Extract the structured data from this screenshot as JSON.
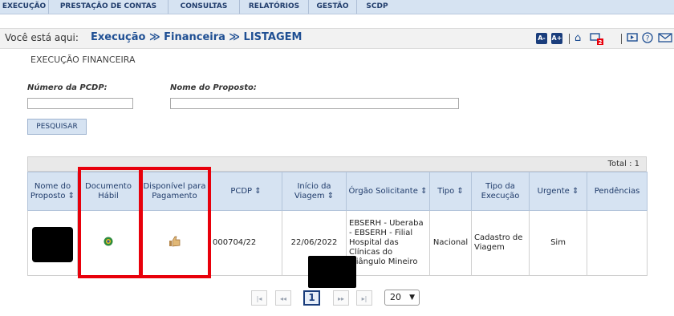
{
  "nav": [
    "EXECUÇÃO",
    "PRESTAÇÃO DE CONTAS",
    "CONSULTAS",
    "RELATÓRIOS",
    "GESTÃO",
    "SCDP"
  ],
  "breadcrumb": {
    "here_label": "Você está aqui:",
    "path": "Execução ≫ Financeira ≫ LISTAGEM"
  },
  "toolbar": {
    "font_decrease": "A-",
    "font_increase": "A+",
    "notification_count": "2"
  },
  "page_title": "EXECUÇÃO FINANCEIRA",
  "search": {
    "pcdp_label": "Número da PCDP:",
    "pcdp_value": "",
    "proposto_label": "Nome do Proposto:",
    "proposto_value": "",
    "button": "PESQUISAR"
  },
  "table": {
    "total": "Total : 1",
    "headers": [
      "Nome do Proposto ⇕",
      "Documento Hábil",
      "Disponível para Pagamento",
      "PCDP ⇕",
      "Início da Viagem ⇕",
      "Órgão Solicitante ⇕",
      "Tipo ⇕",
      "Tipo da Execução",
      "Urgente ⇕",
      "Pendências"
    ],
    "row": {
      "pcdp": "000704/22",
      "inicio": "22/06/2022",
      "orgao": "EBSERH - Uberaba - EBSERH - Filial Hospital das Clínicas do Triângulo Mineiro",
      "tipo": "Nacional",
      "tipo_execucao": "Cadastro de Viagem",
      "urgente": "Sim",
      "pendencias": ""
    }
  },
  "pager": {
    "first": "|◂",
    "prev": "◂◂",
    "current": "1",
    "next": "▸▸",
    "last": "▸|",
    "page_size": "20"
  }
}
